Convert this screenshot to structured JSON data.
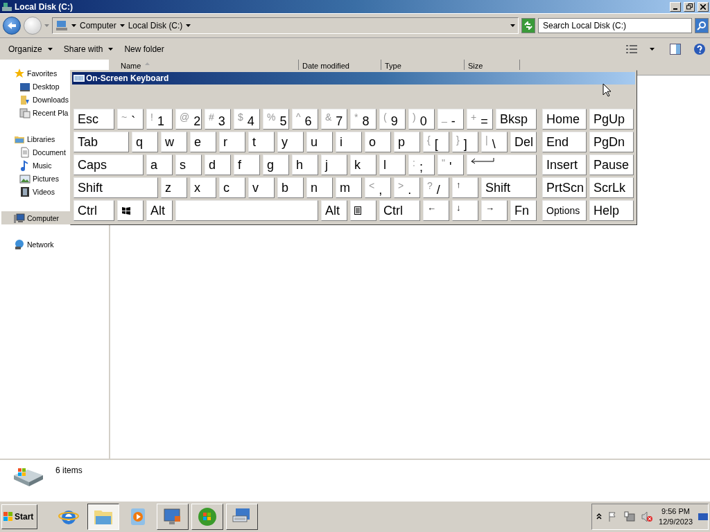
{
  "window": {
    "title": "Local Disk (C:)"
  },
  "address_bar": {
    "breadcrumbs": [
      "Computer",
      "Local Disk (C:)"
    ]
  },
  "search": {
    "placeholder": "Search Local Disk (C:)"
  },
  "toolbar": {
    "buttons": [
      {
        "label": "Organize",
        "dropdown": true
      },
      {
        "label": "Share with",
        "dropdown": true
      },
      {
        "label": "New folder",
        "dropdown": false
      }
    ]
  },
  "sidebar": {
    "items": [
      {
        "label": "Favorites",
        "kind": "star",
        "selected": false,
        "children": [
          {
            "label": "Desktop",
            "kind": "desktop",
            "selected": false
          },
          {
            "label": "Downloads",
            "kind": "downloads",
            "selected": false
          },
          {
            "label": "Recent Pla",
            "kind": "recent",
            "selected": false
          }
        ]
      },
      {
        "label": "Libraries",
        "kind": "libraries",
        "selected": false,
        "children": [
          {
            "label": "Document",
            "kind": "documents",
            "selected": false
          },
          {
            "label": "Music",
            "kind": "music",
            "selected": false
          },
          {
            "label": "Pictures",
            "kind": "pictures",
            "selected": false
          },
          {
            "label": "Videos",
            "kind": "videos",
            "selected": false
          }
        ]
      },
      {
        "label": "Computer",
        "kind": "computer",
        "selected": true
      },
      {
        "label": "Network",
        "kind": "network",
        "selected": false
      }
    ]
  },
  "table": {
    "columns": [
      {
        "label": "Name",
        "sorted": true
      },
      {
        "label": "Date modified",
        "sorted": false
      },
      {
        "label": "Type",
        "sorted": false
      },
      {
        "label": "Size",
        "sorted": false
      }
    ]
  },
  "details": {
    "text": "6 items"
  },
  "keyboard": {
    "title": "On-Screen Keyboard",
    "rows": [
      {
        "keys": [
          {
            "kind": "text",
            "label": "Esc"
          },
          {
            "kind": "dual",
            "shift": "~",
            "label": "`"
          },
          {
            "kind": "dual",
            "shift": "!",
            "label": "1"
          },
          {
            "kind": "dual",
            "shift": "@",
            "label": "2"
          },
          {
            "kind": "dual",
            "shift": "#",
            "label": "3"
          },
          {
            "kind": "dual",
            "shift": "$",
            "label": "4"
          },
          {
            "kind": "dual",
            "shift": "%",
            "label": "5"
          },
          {
            "kind": "dual",
            "shift": "^",
            "label": "6"
          },
          {
            "kind": "dual",
            "shift": "&",
            "label": "7"
          },
          {
            "kind": "dual",
            "shift": "*",
            "label": "8"
          },
          {
            "kind": "dual",
            "shift": "(",
            "label": "9"
          },
          {
            "kind": "dual",
            "shift": ")",
            "label": "0"
          },
          {
            "kind": "dual",
            "shift": "_",
            "label": "-"
          },
          {
            "kind": "dual",
            "shift": "+",
            "label": "="
          },
          {
            "kind": "text",
            "label": "Bksp"
          }
        ]
      },
      {
        "keys": [
          {
            "kind": "text",
            "label": "Tab"
          },
          {
            "kind": "text",
            "label": "q"
          },
          {
            "kind": "text",
            "label": "w"
          },
          {
            "kind": "text",
            "label": "e"
          },
          {
            "kind": "text",
            "label": "r"
          },
          {
            "kind": "text",
            "label": "t"
          },
          {
            "kind": "text",
            "label": "y"
          },
          {
            "kind": "text",
            "label": "u"
          },
          {
            "kind": "text",
            "label": "i"
          },
          {
            "kind": "text",
            "label": "o"
          },
          {
            "kind": "text",
            "label": "p"
          },
          {
            "kind": "dual",
            "shift": "{",
            "label": "["
          },
          {
            "kind": "dual",
            "shift": "}",
            "label": "]"
          },
          {
            "kind": "dual",
            "shift": "|",
            "label": "\\"
          },
          {
            "kind": "text",
            "label": "Del"
          }
        ]
      },
      {
        "keys": [
          {
            "kind": "text",
            "label": "Caps"
          },
          {
            "kind": "text",
            "label": "a"
          },
          {
            "kind": "text",
            "label": "s"
          },
          {
            "kind": "text",
            "label": "d"
          },
          {
            "kind": "text",
            "label": "f"
          },
          {
            "kind": "text",
            "label": "g"
          },
          {
            "kind": "text",
            "label": "h"
          },
          {
            "kind": "text",
            "label": "j"
          },
          {
            "kind": "text",
            "label": "k"
          },
          {
            "kind": "text",
            "label": "l"
          },
          {
            "kind": "dual",
            "shift": ":",
            "label": ";"
          },
          {
            "kind": "dual",
            "shift": "\"",
            "label": "'"
          },
          {
            "kind": "enter"
          }
        ]
      },
      {
        "keys": [
          {
            "kind": "text",
            "label": "Shift"
          },
          {
            "kind": "text",
            "label": "z"
          },
          {
            "kind": "text",
            "label": "x"
          },
          {
            "kind": "text",
            "label": "c"
          },
          {
            "kind": "text",
            "label": "v"
          },
          {
            "kind": "text",
            "label": "b"
          },
          {
            "kind": "text",
            "label": "n"
          },
          {
            "kind": "text",
            "label": "m"
          },
          {
            "kind": "dual",
            "shift": "<",
            "label": ","
          },
          {
            "kind": "dual",
            "shift": ">",
            "label": "."
          },
          {
            "kind": "dual",
            "shift": "?",
            "label": "/"
          },
          {
            "kind": "arrow",
            "label": "↑"
          },
          {
            "kind": "text",
            "label": "Shift"
          }
        ]
      },
      {
        "keys": [
          {
            "kind": "text",
            "label": "Ctrl"
          },
          {
            "kind": "windows"
          },
          {
            "kind": "text",
            "label": "Alt"
          },
          {
            "kind": "space"
          },
          {
            "kind": "text",
            "label": "Alt"
          },
          {
            "kind": "menu"
          },
          {
            "kind": "text",
            "label": "Ctrl"
          },
          {
            "kind": "arrow",
            "label": "←"
          },
          {
            "kind": "arrow",
            "label": "↓"
          },
          {
            "kind": "arrow",
            "label": "→"
          },
          {
            "kind": "text",
            "label": "Fn"
          }
        ]
      }
    ],
    "nav": [
      [
        {
          "kind": "text",
          "label": "Home"
        },
        {
          "kind": "text",
          "label": "PgUp"
        }
      ],
      [
        {
          "kind": "text",
          "label": "End"
        },
        {
          "kind": "text",
          "label": "PgDn"
        }
      ],
      [
        {
          "kind": "text",
          "label": "Insert"
        },
        {
          "kind": "text",
          "label": "Pause"
        }
      ],
      [
        {
          "kind": "text",
          "label": "PrtScn"
        },
        {
          "kind": "text",
          "label": "ScrLk"
        }
      ],
      [
        {
          "kind": "small",
          "label": "Options"
        },
        {
          "kind": "text",
          "label": "Help"
        }
      ]
    ]
  },
  "taskbar": {
    "start": "Start",
    "buttons": [
      {
        "kind": "browser",
        "open": false,
        "selected": false
      },
      {
        "kind": "explorer",
        "open": true,
        "selected": true
      },
      {
        "kind": "player",
        "open": false,
        "selected": false
      },
      {
        "kind": "remote",
        "open": true,
        "selected": false
      },
      {
        "kind": "media",
        "open": true,
        "selected": false
      },
      {
        "kind": "keyboard",
        "open": true,
        "selected": false
      }
    ],
    "tray": {
      "volume_muted": true,
      "time": "9:56 PM",
      "date": "12/9/2023"
    }
  }
}
